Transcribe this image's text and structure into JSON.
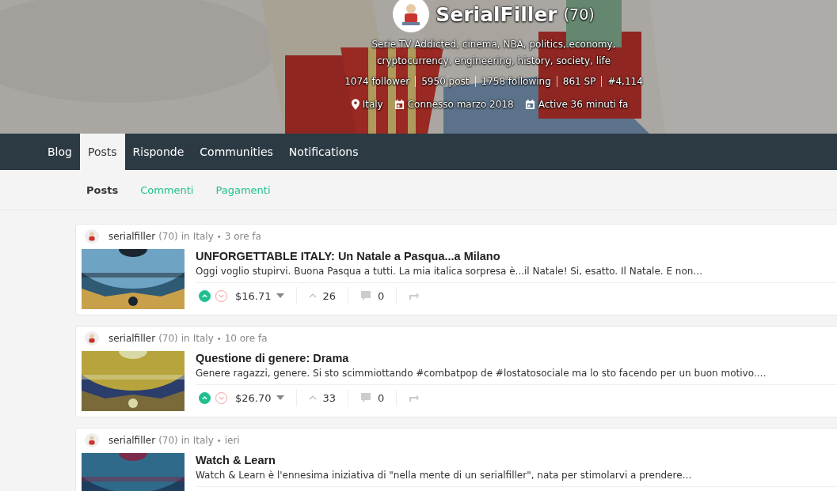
{
  "profile": {
    "name": "SerialFiller",
    "reputation": "(70)",
    "about": "Serie TV Addicted, cinema, NBA, politics, economy, cryptocurrency, engineering, history, society, life",
    "stats": [
      "1074 follower",
      "5950 post",
      "1758 following",
      "861 SP",
      "#4,114"
    ],
    "meta": [
      {
        "kind": "location",
        "text": "Italy"
      },
      {
        "kind": "calendar",
        "text": "Connesso marzo 2018"
      },
      {
        "kind": "calendar",
        "text": "Active 36 minuti fa"
      }
    ]
  },
  "nav": [
    {
      "label": "Blog",
      "selected": false
    },
    {
      "label": "Posts",
      "selected": true
    },
    {
      "label": "Risponde",
      "selected": false
    },
    {
      "label": "Communities",
      "selected": false
    },
    {
      "label": "Notifications",
      "selected": false
    }
  ],
  "subtabs": [
    {
      "label": "Posts",
      "selected": true
    },
    {
      "label": "Commenti",
      "selected": false
    },
    {
      "label": "Pagamenti",
      "selected": false
    }
  ],
  "posts": [
    {
      "author": "serialfiller",
      "reputation": "(70)",
      "in": "in",
      "community": "Italy",
      "separator": "•",
      "time": "3 ore fa",
      "title": "UNFORGETTABLE ITALY: Un Natale a Pasqua...a Milano",
      "excerpt": "Oggi voglio stupirvi. Buona Pasqua a tutti. La mia italica sorpresa è...il Natale! Si, esatto. Il Natale. E non…",
      "upvoted": true,
      "downvoted": false,
      "payout": "$16.71",
      "votes": "26",
      "comments": "0"
    },
    {
      "author": "serialfiller",
      "reputation": "(70)",
      "in": "in",
      "community": "Italy",
      "separator": "•",
      "time": "10 ore fa",
      "title": "Questione di genere: Drama",
      "excerpt": "Genere ragazzi, genere. Si sto scimmiottando #combatpop de #lostatosociale ma lo sto facendo per un buon motivo.…",
      "upvoted": true,
      "downvoted": false,
      "payout": "$26.70",
      "votes": "33",
      "comments": "0"
    },
    {
      "author": "serialfiller",
      "reputation": "(70)",
      "in": "in",
      "community": "Italy",
      "separator": "•",
      "time": "ieri",
      "title": "Watch & Learn",
      "excerpt": "Watch & Learn è l'ennesima iniziativa di \"nella mente di un serialfiller\", nata per stimolarvi a prendere…"
    }
  ]
}
